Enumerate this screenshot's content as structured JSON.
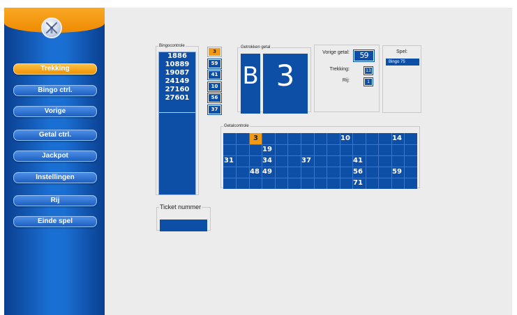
{
  "sidebar": {
    "logo_icon": "windmill-icon",
    "items": [
      {
        "label": "Trekking",
        "active": true
      },
      {
        "label": "Bingo ctrl."
      },
      {
        "label": "Vorige"
      },
      {
        "label": "Getal ctrl."
      },
      {
        "label": "Jackpot"
      },
      {
        "label": "Instellingen"
      },
      {
        "label": "Rij"
      },
      {
        "label": "Einde spel"
      }
    ]
  },
  "bingocontrole": {
    "legend": "Bingocontrole",
    "numbers": [
      "1886",
      "10889",
      "19087",
      "24149",
      "27160",
      "27601"
    ]
  },
  "previous_numbers": [
    "3",
    "59",
    "41",
    "10",
    "56",
    "37"
  ],
  "drawn": {
    "legend": "Getrokken getal",
    "letter": "B",
    "number": "3"
  },
  "info": {
    "vorige_label": "Vorige getal:",
    "vorige_value": "59",
    "trekking_label": "Trekking:",
    "trekking_value": "13",
    "rij_label": "Rij:",
    "rij_value": "1"
  },
  "spel": {
    "label": "Spel:",
    "value": "Bingo 75"
  },
  "getalcontrole": {
    "legend": "Getalcontrole",
    "rows": [
      [
        "3",
        "10",
        "14"
      ],
      [
        "19"
      ],
      [
        "31",
        "34",
        "37",
        "41"
      ],
      [
        "48",
        "49",
        "56",
        "59"
      ],
      [
        "71"
      ]
    ]
  },
  "ticket": {
    "legend": "Ticket nummer",
    "value": ""
  },
  "colors": {
    "panel_blue": "#0d4ea6",
    "highlight_orange": "#f39a15",
    "sidebar_blue": "#1a6fd3"
  }
}
